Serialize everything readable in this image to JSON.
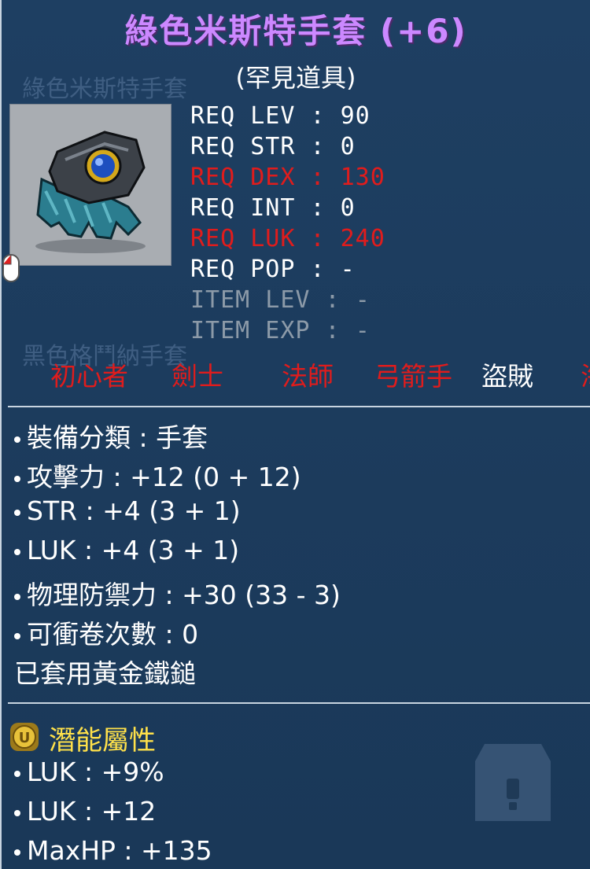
{
  "item": {
    "title": "綠色米斯特手套 (+6)",
    "rarity": "(罕見道具)",
    "ghost_name_1": "綠色米斯特手套",
    "ghost_name_2": "黑色格鬥納手套"
  },
  "requirements": [
    {
      "label": "REQ LEV",
      "value": "90",
      "status": "met"
    },
    {
      "label": "REQ STR",
      "value": "0",
      "status": "met"
    },
    {
      "label": "REQ DEX",
      "value": "130",
      "status": "unmet"
    },
    {
      "label": "REQ INT",
      "value": "0",
      "status": "met"
    },
    {
      "label": "REQ LUK",
      "value": "240",
      "status": "unmet"
    },
    {
      "label": "REQ POP",
      "value": "-",
      "status": "met"
    },
    {
      "label": "ITEM LEV",
      "value": "-",
      "status": "na"
    },
    {
      "label": "ITEM EXP",
      "value": "-",
      "status": "na"
    }
  ],
  "jobs": [
    {
      "label": "初心者",
      "allowed": false
    },
    {
      "label": "劍士",
      "allowed": false
    },
    {
      "label": "法師",
      "allowed": false
    },
    {
      "label": "弓箭手",
      "allowed": false
    },
    {
      "label": "盜賊",
      "allowed": true
    },
    {
      "label": "海",
      "allowed": false
    }
  ],
  "stats": [
    "裝備分類 : 手套",
    "攻擊力 : +12 (0 + 12)",
    "STR : +4 (3 + 1)",
    "LUK : +4 (3 + 1)",
    "物理防禦力 : +30 (33 - 3)",
    "可衝卷次數 : 0"
  ],
  "enhancement_note": "已套用黃金鐵鎚",
  "potential": {
    "title": "潛能屬性",
    "lines": [
      "LUK : +9%",
      "LUK : +12",
      "MaxHP : +135"
    ]
  },
  "colors": {
    "title": "#cc88ff",
    "unmet": "#e01c1c",
    "potential_title": "#ffe14a",
    "background": "#1b3a5c"
  }
}
